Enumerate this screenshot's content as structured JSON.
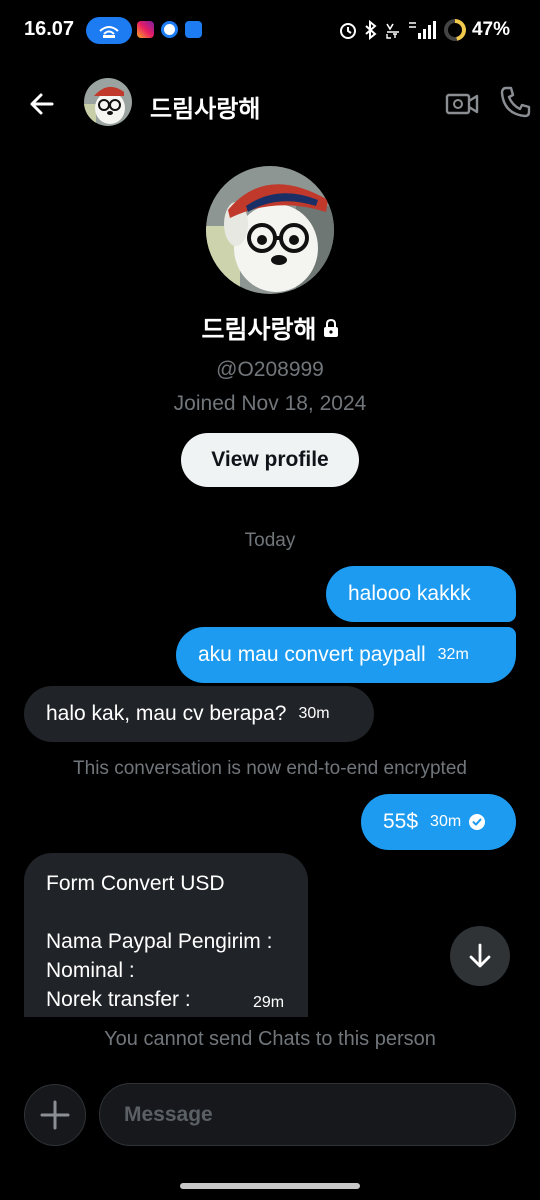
{
  "status_bar": {
    "time": "16.07",
    "battery": "47%",
    "icons": [
      "hotspot-icon",
      "instagram-icon",
      "browser-icon",
      "store-icon",
      "alarm-icon",
      "bluetooth-icon",
      "volte-icon",
      "signal-icon"
    ]
  },
  "header": {
    "name": "드림사랑해",
    "icons": [
      "back-arrow-icon",
      "video-call-icon",
      "phone-icon"
    ]
  },
  "profile": {
    "name": "드림사랑해",
    "handle": "@O208999",
    "joined": "Joined Nov 18, 2024",
    "view_profile_label": "View profile",
    "locked": true
  },
  "conversation": {
    "day_label": "Today",
    "messages": [
      {
        "direction": "out",
        "text": "halooo kakkk",
        "time": ""
      },
      {
        "direction": "out",
        "text": "aku mau convert paypall",
        "time": "32m"
      },
      {
        "direction": "in",
        "text": "halo kak, mau cv berapa?",
        "time": "30m"
      },
      {
        "direction": "out",
        "text": "55$",
        "time": "30m",
        "read": true
      },
      {
        "direction": "in",
        "lines": [
          "Form Convert USD",
          "",
          "Nama Paypal Pengirim :",
          "Nominal :",
          "Norek transfer :"
        ],
        "time": "29m"
      }
    ],
    "encryption_note": "This conversation is now end-to-end encrypted"
  },
  "composer": {
    "notice": "You cannot send Chats to this person",
    "placeholder": "Message"
  },
  "colors": {
    "background": "#000000",
    "outgoing_bubble": "#1d9bf0",
    "incoming_bubble": "#202327",
    "muted_text": "#71767b",
    "hotspot_pill": "#1d7cf2",
    "battery_ring": "#f2c94c"
  }
}
